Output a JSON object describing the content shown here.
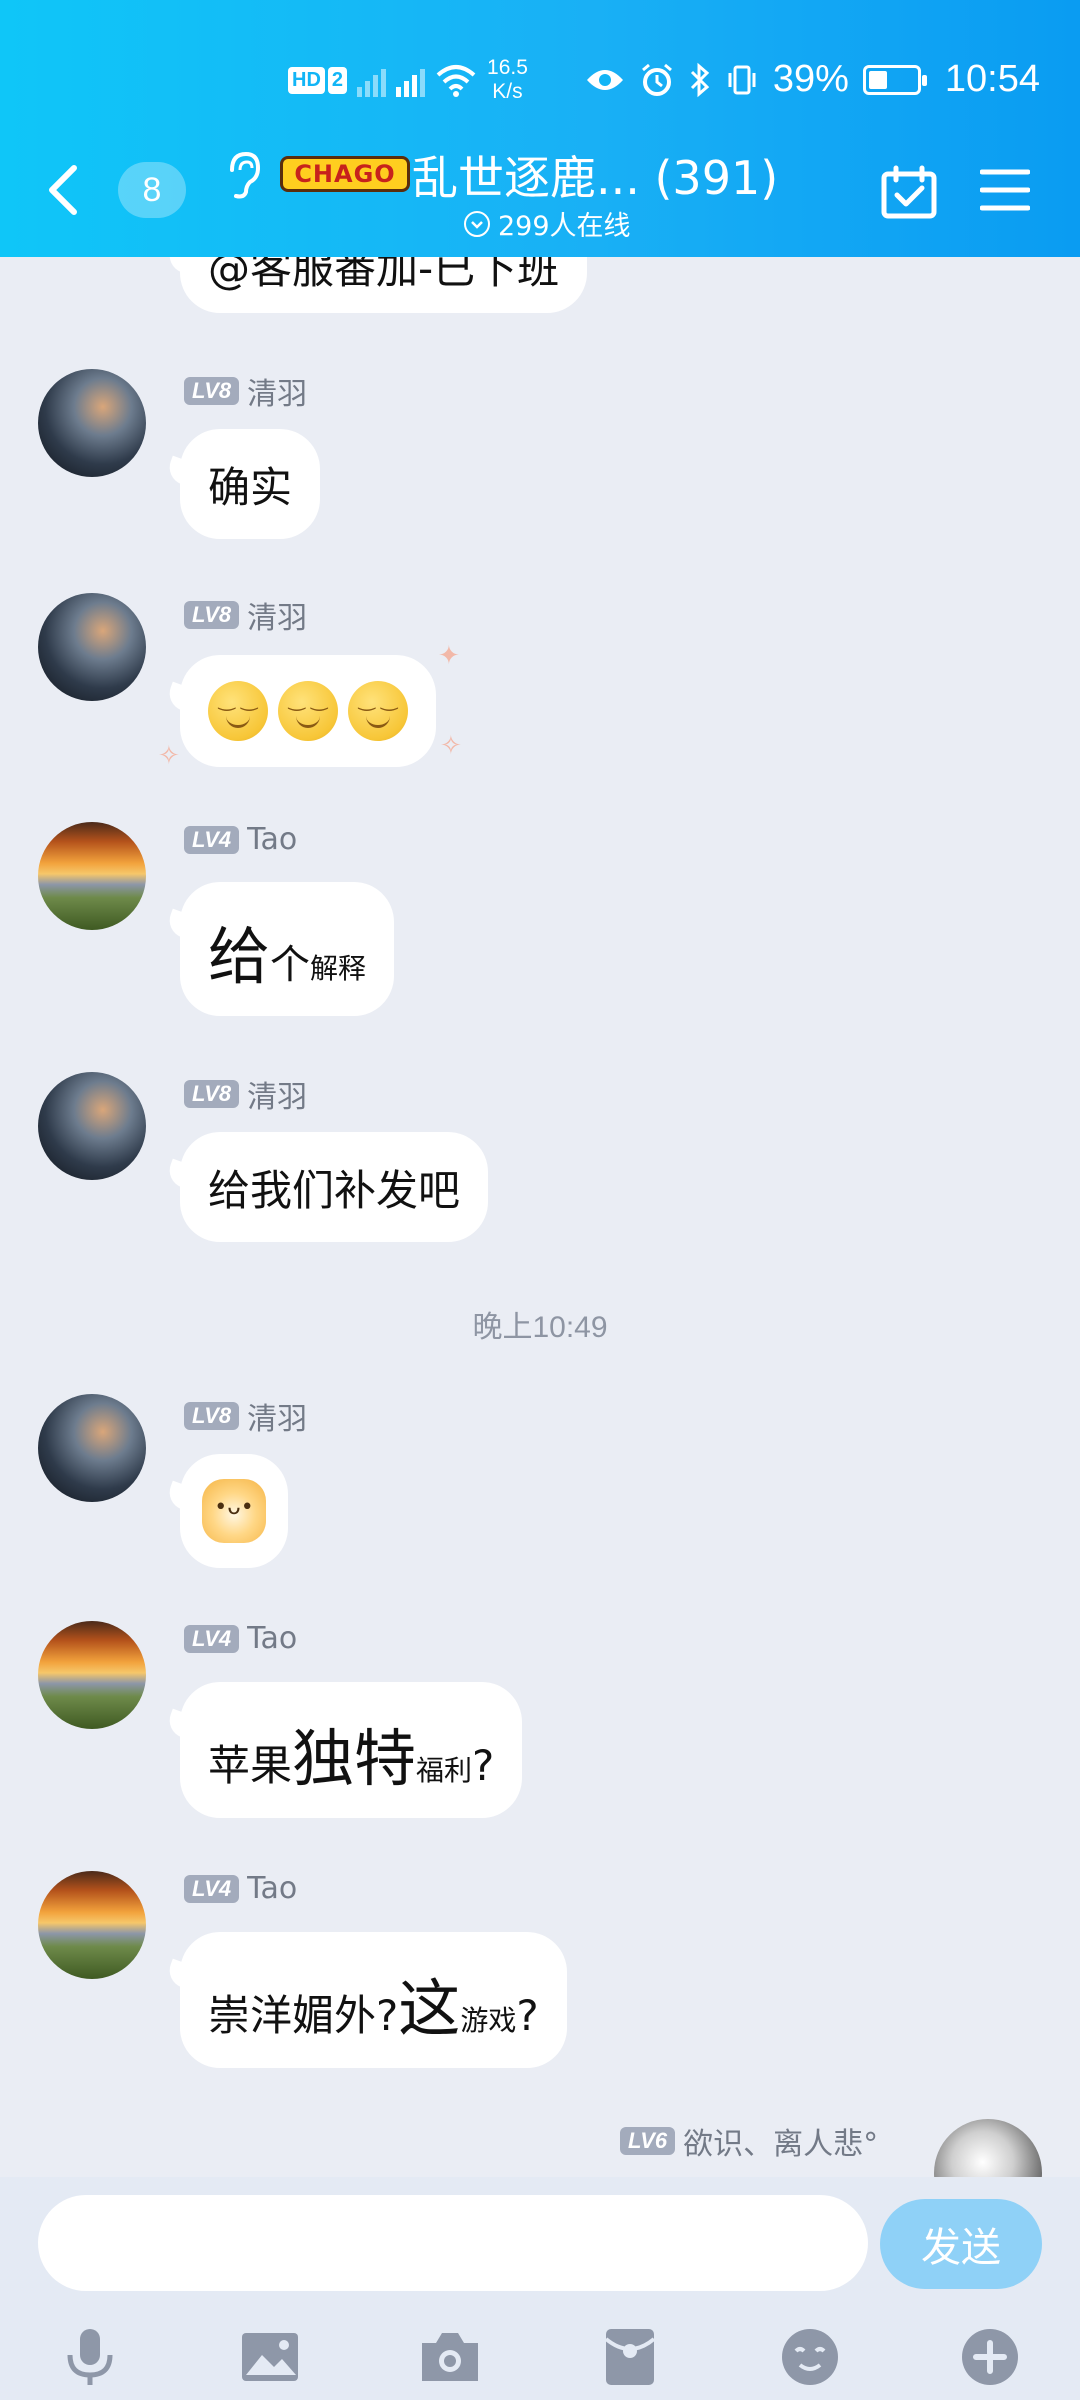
{
  "status_bar": {
    "net_speed_value": "16.5",
    "net_speed_unit": "K/s",
    "battery": "39%",
    "battery_level": 0.39,
    "time": "10:54"
  },
  "nav": {
    "unread_count": "8",
    "game_logo_text": "CHAGO",
    "title": "乱世逐鹿... (391)",
    "online": "299人在线"
  },
  "messages": [
    {
      "type": "partial",
      "text": "@客服番加-已下班"
    },
    {
      "sender": "清羽",
      "level": "LV8",
      "text": "确实"
    },
    {
      "sender": "清羽",
      "level": "LV8",
      "emoji": [
        "relieved-face",
        "relieved-face",
        "relieved-face"
      ]
    },
    {
      "sender": "Tao",
      "level": "LV4",
      "parts": [
        "给",
        "个",
        "解释"
      ]
    },
    {
      "sender": "清羽",
      "level": "LV8",
      "text": "给我们补发吧"
    },
    {
      "timestamp": "晚上10:49"
    },
    {
      "sender": "清羽",
      "level": "LV8",
      "sticker": "shiba-dog-sticker"
    },
    {
      "sender": "Tao",
      "level": "LV4",
      "parts": [
        "苹果",
        "独特",
        "福利",
        "?"
      ]
    },
    {
      "sender": "Tao",
      "level": "LV4",
      "parts": [
        "崇洋媚外?",
        "这",
        "游戏",
        "?"
      ]
    },
    {
      "sender": "欲识、离人悲°",
      "level": "LV6",
      "self": true
    }
  ],
  "input": {
    "placeholder": "",
    "send_label": "发送"
  },
  "toolbar": [
    "mic-icon",
    "image-icon",
    "camera-icon",
    "red-packet-icon",
    "emoji-icon",
    "plus-icon"
  ],
  "colors": {
    "header_start": "#0fc6f8",
    "header_end": "#0a9cf2",
    "chat_bg": "#eaedf4",
    "bubble": "#ffffff",
    "level_badge": "#a3abbc",
    "send_button": "#8fd1f7"
  }
}
